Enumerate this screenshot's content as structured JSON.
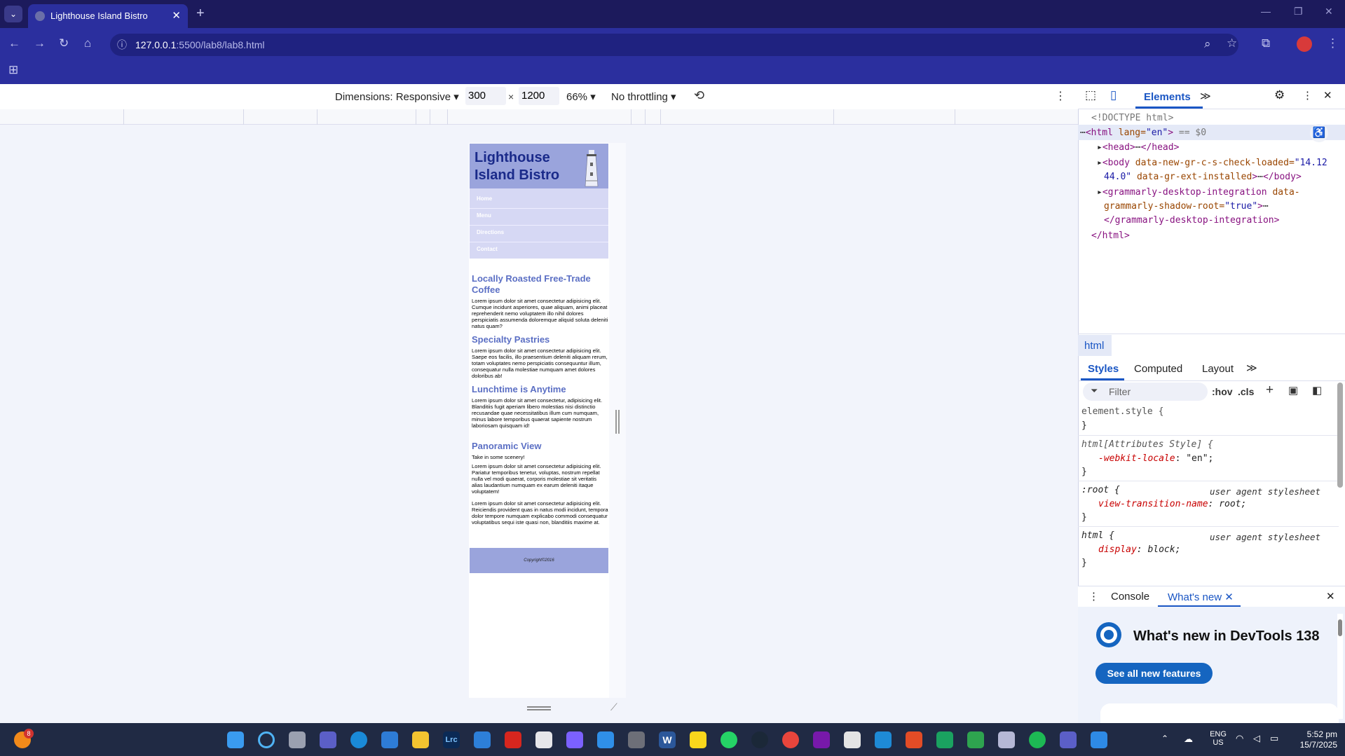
{
  "browser": {
    "tab_title": "Lighthouse Island Bistro",
    "tab_close": "✕",
    "new_tab": "+",
    "url_host": "127.0.0.1",
    "url_path": ":5500/lab8/lab8.html"
  },
  "device_toolbar": {
    "dimensions_label": "Dimensions: Responsive ▾",
    "width": "300",
    "times": "×",
    "height": "1200",
    "zoom": "66% ▾",
    "throttling": "No throttling ▾"
  },
  "site": {
    "title": "Lighthouse Island Bistro",
    "nav": [
      "Home",
      "Menu",
      "Directions",
      "Contact"
    ],
    "sections": [
      {
        "heading": "Locally Roasted Free-Trade Coffee",
        "text": "Lorem ipsum dolor sit amet consectetur adipisicing elit. Cumque incidunt asperiores, quae aliquam, animi placeat reprehenderit nemo voluptatem illo nihil dolores perspiciatis assumenda doloremque aliquid soluta deleniti natus quam?"
      },
      {
        "heading": "Specialty Pastries",
        "text": "Lorem ipsum dolor sit amet consectetur adipisicing elit. Saepe eos facilis, illo praesentium deleniti aliquam rerum, totam voluptates nemo perspiciatis consequuntur illum, consequatur nulla molestiae numquam amet dolores doloribus ab!"
      },
      {
        "heading": "Lunchtime is Anytime",
        "text": "Lorem ipsum dolor sit amet consectetur, adipisicing elit. Blanditiis fugit aperiam libero molestias nisi distinctio recusandae quae necessitatibus illum cum numquam, minus labore temporibus quaerat sapiente nostrum laboriosam quisquam id!"
      },
      {
        "heading": "Panoramic View",
        "intro": "Take in some scenery!",
        "text": "Lorem ipsum dolor sit amet consectetur adipisicing elit. Pariatur temporibus tenetur, voluptas, nostrum repellat nulla vel modi quaerat, corporis molestiae sit veritatis alias laudantium numquam ex earum deleniti itaque voluptatem!",
        "text2": "Lorem ipsum dolor sit amet consectetur adipisicing elit. Reiciendis provident quas in natus modi incidunt, tempora dolor tempore numquam explicabo commodi consequatur voluptatibus sequi iste quasi non, blanditiis maxime at."
      }
    ],
    "footer": "Copyright©2016"
  },
  "devtools": {
    "tab_elements": "Elements",
    "more_tabs": "≫",
    "dom": {
      "doctype": "<!DOCTYPE html>",
      "html_open_a": "<html",
      "html_lang_attr": " lang=",
      "html_lang_val": "\"en\"",
      "html_close_bracket": ">",
      "html_sel": " == $0",
      "head_open": "<head>",
      "ellipsis": "⋯",
      "head_close": "</head>",
      "body_open": "<body",
      "body_attr1": " data-new-gr-c-s-check-loaded=",
      "body_val1a": "\"14.12",
      "body_val1b": "44.0\"",
      "body_attr2": " data-gr-ext-installed",
      "body_gt": ">",
      "body_close": "</body>",
      "gram_open": "<grammarly-desktop-integration",
      "gram_attr1": " data-",
      "gram_attr1b": "grammarly-shadow-root=",
      "gram_val1": "\"true\"",
      "gram_gt": ">",
      "gram_close": "</grammarly-desktop-integration>",
      "html_close": "</html>"
    },
    "breadcrumb": "html",
    "styles_tabs": [
      "Styles",
      "Computed",
      "Layout"
    ],
    "filter_placeholder": "Filter",
    "hov": ":hov",
    "cls": ".cls",
    "rules": {
      "element_style": "element.style {",
      "close": "}",
      "html_attr_sel": "html[Attributes Style] {",
      "webkit_locale_prop": "-webkit-locale",
      "webkit_locale_val": ": \"en\";",
      "root_sel": ":root {",
      "ua": "user agent stylesheet",
      "vtn_prop": "view-transition-name",
      "vtn_val": ": root;",
      "html_sel": "html {",
      "display_prop": "display",
      "display_val": ": block;"
    },
    "drawer_tabs": [
      "Console",
      "What's new"
    ],
    "whats_new_title": "What's new in DevTools 138",
    "see_all": "See all new features"
  },
  "taskbar": {
    "notification_count": "8",
    "lang": "ENG",
    "region": "US",
    "time": "5:52 pm",
    "date": "15/7/2025"
  }
}
